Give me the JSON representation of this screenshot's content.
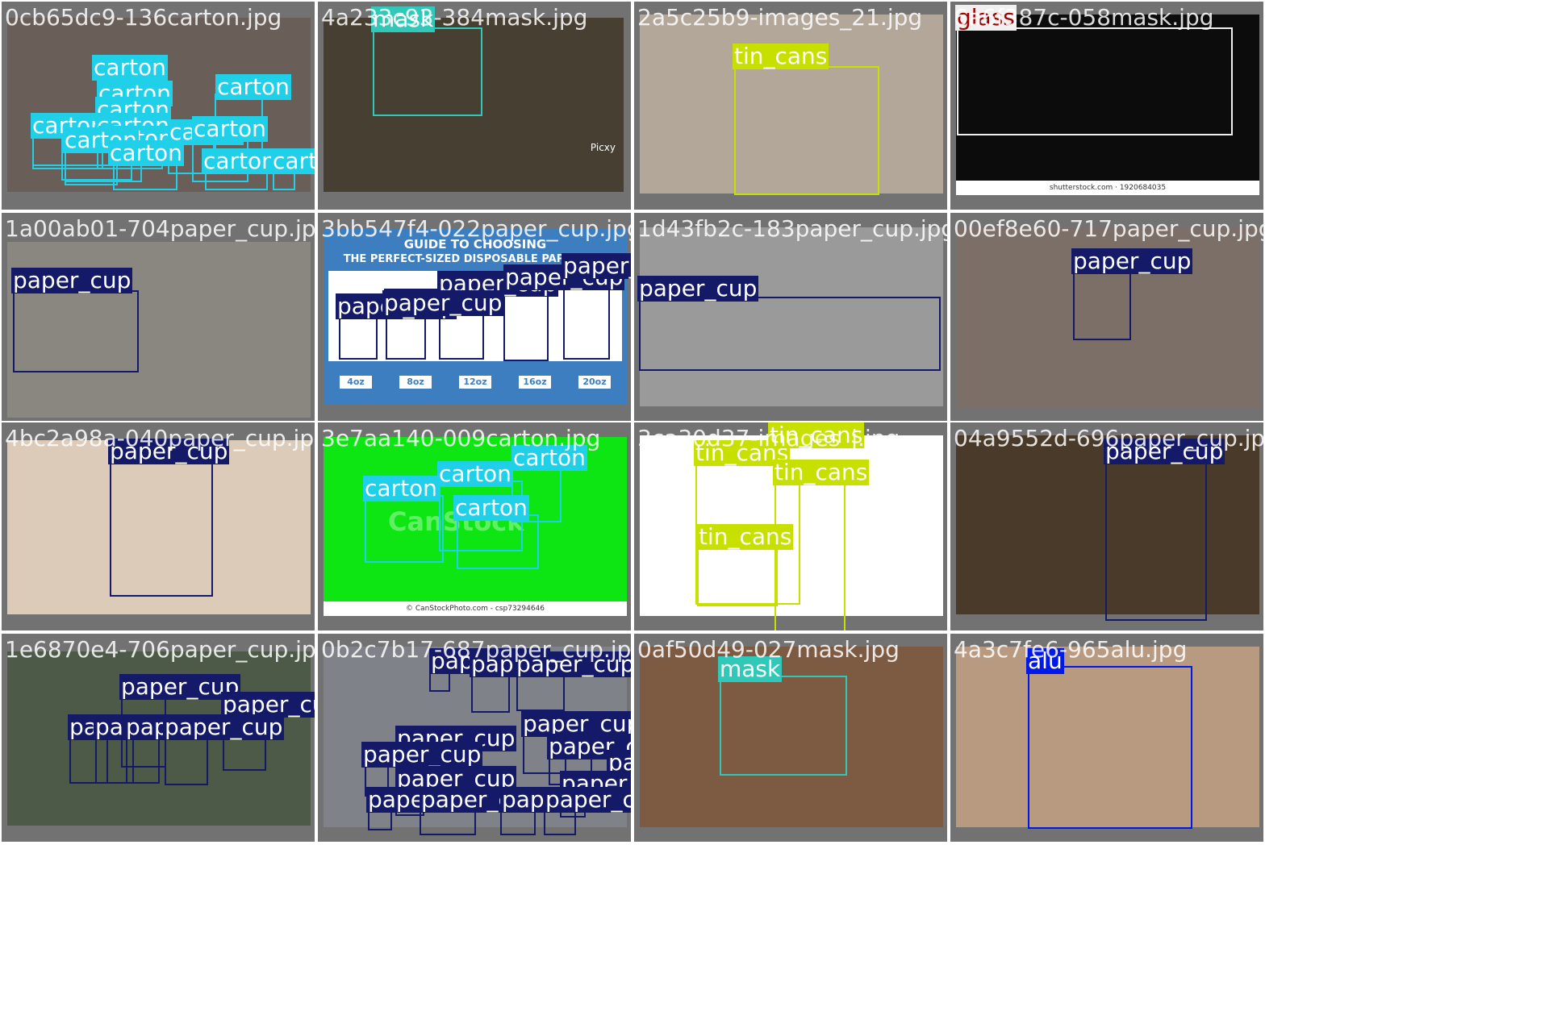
{
  "class_colors": {
    "carton": "#20d0e8",
    "mask": "#30c8b8",
    "tin_cans": "#c8e000",
    "glass": "#f0f0f0",
    "paper_cup": "#141a68",
    "alu": "#0018e8"
  },
  "label_text_colors": {
    "carton": "#ffffff",
    "mask": "#ffffff",
    "tin_cans": "#ffffff",
    "glass": "#a00000",
    "paper_cup": "#ffffff",
    "alu": "#ffffff"
  },
  "tiles": [
    {
      "filename": "0cb65dc9-136carton.jpg",
      "photo_color": "#6a5e58",
      "labels": [
        "carton",
        "carton",
        "carton",
        "carton",
        "carton",
        "carton",
        "carton",
        "carton",
        "carton",
        "carton",
        "carton",
        "carton",
        "carton"
      ]
    },
    {
      "filename": "4a233c93-384mask.jpg",
      "photo_color": "#463f32",
      "watermark": "Picxy",
      "labels": [
        "mask"
      ]
    },
    {
      "filename": "2a5c25b9-images_21.jpg",
      "photo_color": "#b3a79a",
      "labels": [
        "tin_cans"
      ]
    },
    {
      "filename": "6a6f387c-058mask.jpg",
      "photo_color": "#0c0c0c",
      "caption": "shutterstock.com · 1920684035",
      "labels": [
        "glass"
      ]
    },
    {
      "filename": "1a00ab01-704paper_cup.jpg",
      "photo_color": "#8a8680",
      "labels": [
        "paper_cup"
      ]
    },
    {
      "filename": "3bb547f4-022paper_cup.jpg",
      "photo_color": "#3d7ec0",
      "infographic": {
        "title_line1": "GUIDE TO CHOOSING",
        "title_line2": "THE PERFECT-SIZED DISPOSABLE PAPER CUP",
        "sizes": [
          "4oz",
          "8oz",
          "12oz",
          "16oz",
          "20oz"
        ]
      },
      "labels": [
        "paper_cup",
        "paper_cup",
        "paper_cup",
        "paper_cup",
        "paper_cup",
        "paper_cup"
      ]
    },
    {
      "filename": "1d43fb2c-183paper_cup.jpg",
      "photo_color": "#9a9a9a",
      "labels": [
        "paper_cup"
      ]
    },
    {
      "filename": "00ef8e60-717paper_cup.jpg",
      "photo_color": "#7b6f68",
      "labels": [
        "paper_cup"
      ]
    },
    {
      "filename": "4bc2a98a-040paper_cup.jpg",
      "photo_color": "#dccbb8",
      "labels": [
        "paper_cup"
      ]
    },
    {
      "filename": "3e7aa140-009carton.jpg",
      "photo_color": "#0ee614",
      "caption": "© CanStockPhoto.com - csp73294646",
      "watermark": "CanStock",
      "labels": [
        "carton",
        "carton",
        "carton",
        "carton"
      ]
    },
    {
      "filename": "3ca30d37-images_j.jpg",
      "photo_color": "#ffffff",
      "labels": [
        "tin_cans",
        "tin_cans",
        "tin_cans",
        "tin_cans"
      ]
    },
    {
      "filename": "04a9552d-696paper_cup.jpg",
      "photo_color": "#4a3a2a",
      "labels": [
        "paper_cup"
      ]
    },
    {
      "filename": "1e6870e4-706paper_cup.jpg",
      "photo_color": "#4d5a48",
      "labels": [
        "paper_cup",
        "paper_cup",
        "paper_cup",
        "paper_cup",
        "paper_cup",
        "paper_cup"
      ]
    },
    {
      "filename": "0b2c7b17-687paper_cup.jpg",
      "photo_color": "#7f8288",
      "labels": [
        "paper_cup",
        "paper_cup",
        "paper_cup",
        "paper_cup",
        "paper_cup",
        "paper_cup",
        "paper_cup",
        "paper_cup",
        "paper_cup",
        "paper_cup",
        "paper_cup",
        "paper_cup",
        "paper_cup",
        "paper_cup"
      ]
    },
    {
      "filename": "0af50d49-027mask.jpg",
      "photo_color": "#7d5a42",
      "labels": [
        "mask"
      ]
    },
    {
      "filename": "4a3c7fe6-965alu.jpg",
      "photo_color": "#b89a80",
      "labels": [
        "alu"
      ]
    }
  ]
}
